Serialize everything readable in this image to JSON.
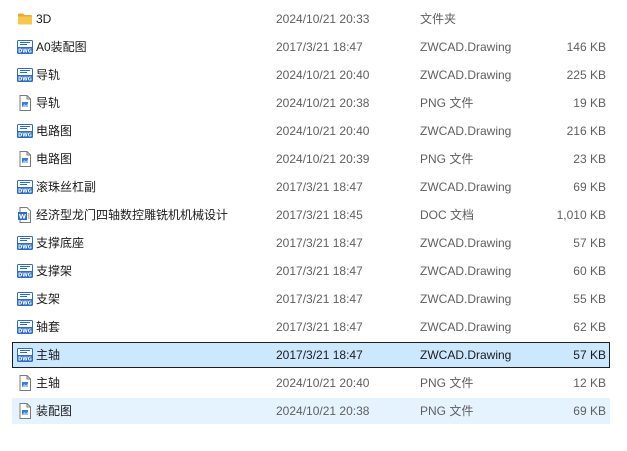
{
  "files": [
    {
      "name": "3D",
      "date": "2024/10/21 20:33",
      "type": "文件夹",
      "size": "",
      "icon": "folder-icon"
    },
    {
      "name": "A0装配图",
      "date": "2017/3/21 18:47",
      "type": "ZWCAD.Drawing",
      "size": "146 KB",
      "icon": "dwg-icon"
    },
    {
      "name": "导轨",
      "date": "2024/10/21 20:40",
      "type": "ZWCAD.Drawing",
      "size": "225 KB",
      "icon": "dwg-icon"
    },
    {
      "name": "导轨",
      "date": "2024/10/21 20:38",
      "type": "PNG 文件",
      "size": "19 KB",
      "icon": "png-icon"
    },
    {
      "name": "电路图",
      "date": "2024/10/21 20:40",
      "type": "ZWCAD.Drawing",
      "size": "216 KB",
      "icon": "dwg-icon"
    },
    {
      "name": "电路图",
      "date": "2024/10/21 20:39",
      "type": "PNG 文件",
      "size": "23 KB",
      "icon": "png-icon"
    },
    {
      "name": "滚珠丝杠副",
      "date": "2017/3/21 18:47",
      "type": "ZWCAD.Drawing",
      "size": "69 KB",
      "icon": "dwg-icon"
    },
    {
      "name": "经济型龙门四轴数控雕铣机机械设计",
      "date": "2017/3/21 18:45",
      "type": "DOC 文档",
      "size": "1,010 KB",
      "icon": "doc-icon"
    },
    {
      "name": "支撑底座",
      "date": "2017/3/21 18:47",
      "type": "ZWCAD.Drawing",
      "size": "57 KB",
      "icon": "dwg-icon"
    },
    {
      "name": "支撑架",
      "date": "2017/3/21 18:47",
      "type": "ZWCAD.Drawing",
      "size": "60 KB",
      "icon": "dwg-icon"
    },
    {
      "name": "支架",
      "date": "2017/3/21 18:47",
      "type": "ZWCAD.Drawing",
      "size": "55 KB",
      "icon": "dwg-icon"
    },
    {
      "name": "轴套",
      "date": "2017/3/21 18:47",
      "type": "ZWCAD.Drawing",
      "size": "62 KB",
      "icon": "dwg-icon"
    },
    {
      "name": "主轴",
      "date": "2017/3/21 18:47",
      "type": "ZWCAD.Drawing",
      "size": "57 KB",
      "icon": "dwg-icon",
      "state": "selected"
    },
    {
      "name": "主轴",
      "date": "2024/10/21 20:40",
      "type": "PNG 文件",
      "size": "12 KB",
      "icon": "png-icon"
    },
    {
      "name": "装配图",
      "date": "2024/10/21 20:38",
      "type": "PNG 文件",
      "size": "69 KB",
      "icon": "png-icon",
      "state": "hover"
    }
  ],
  "colors": {
    "selected_bg": "#cce8ff",
    "hover_bg": "#e5f3ff",
    "folder": "#f6c74f",
    "dwg": "#2b6cc4",
    "doc": "#2b6cc4"
  }
}
